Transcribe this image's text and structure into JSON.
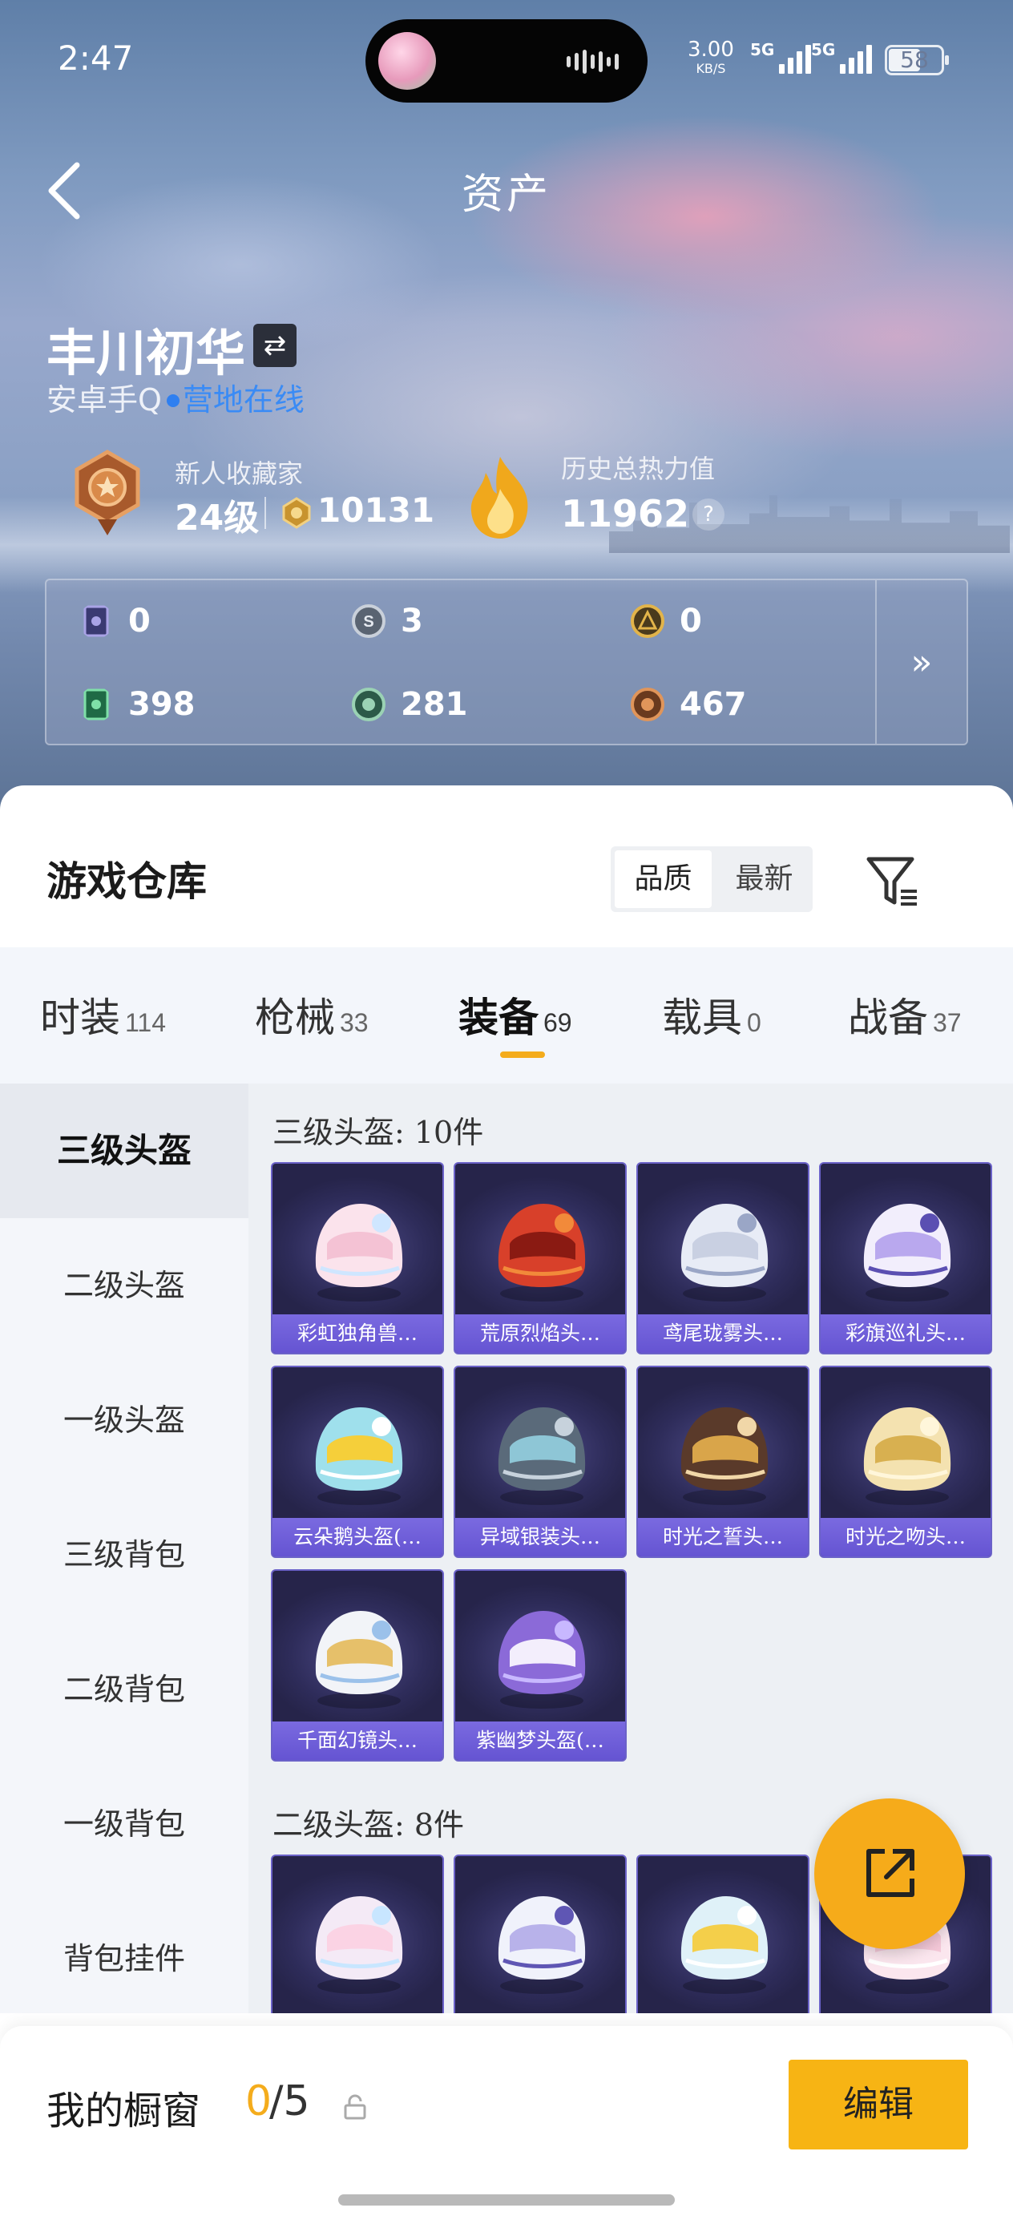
{
  "status_bar": {
    "time": "2:47",
    "speed": "3.00",
    "speed_unit": "KB/S",
    "net1": "5G",
    "net2": "5G",
    "battery": "58"
  },
  "nav": {
    "title": "资产"
  },
  "profile": {
    "name": "丰川初华",
    "platform": "安卓手Q",
    "online_status": "营地在线",
    "rank_title": "新人收藏家",
    "rank_level": "24级",
    "rank_coins": "10131",
    "heat_title": "历史总热力值",
    "heat_value": "11962",
    "help": "?"
  },
  "counters": [
    {
      "icon": "purple-card-icon",
      "value": "0"
    },
    {
      "icon": "silver-coin-icon",
      "value": "3"
    },
    {
      "icon": "gold-coin-icon",
      "value": "0"
    },
    {
      "icon": "green-card-icon",
      "value": "398"
    },
    {
      "icon": "green-coin-icon",
      "value": "281"
    },
    {
      "icon": "bronze-coin-icon",
      "value": "467"
    }
  ],
  "counters_more": "»",
  "warehouse": {
    "title": "游戏仓库",
    "sort_options": [
      "品质",
      "最新"
    ],
    "sort_active": "品质"
  },
  "tabs": [
    {
      "label": "时装",
      "count": "114"
    },
    {
      "label": "枪械",
      "count": "33"
    },
    {
      "label": "装备",
      "count": "69",
      "active": true
    },
    {
      "label": "载具",
      "count": "0"
    },
    {
      "label": "战备",
      "count": "37"
    }
  ],
  "side_categories": [
    "三级头盔",
    "二级头盔",
    "一级头盔",
    "三级背包",
    "二级背包",
    "一级背包",
    "背包挂件"
  ],
  "groups": [
    {
      "heading": "三级头盔: 10件",
      "items": [
        "彩虹独角兽…",
        "荒原烈焰头…",
        "鸢尾珑雾头…",
        "彩旗巡礼头…",
        "云朵鹅头盔(…",
        "异域银装头…",
        "时光之誓头…",
        "时光之吻头…",
        "千面幻镜头…",
        "紫幽梦头盔(…"
      ]
    },
    {
      "heading": "二级头盔: 8件",
      "items": [
        "",
        "",
        "",
        ""
      ]
    }
  ],
  "showcase": {
    "label": "我的橱窗",
    "used": "0",
    "cap": "/5",
    "edit_label": "编辑"
  },
  "colors": {
    "accent": "#f6ab1a",
    "card_bg": "#2e2c5a",
    "card_label": "#6554d2",
    "online": "#3a8bf5"
  }
}
